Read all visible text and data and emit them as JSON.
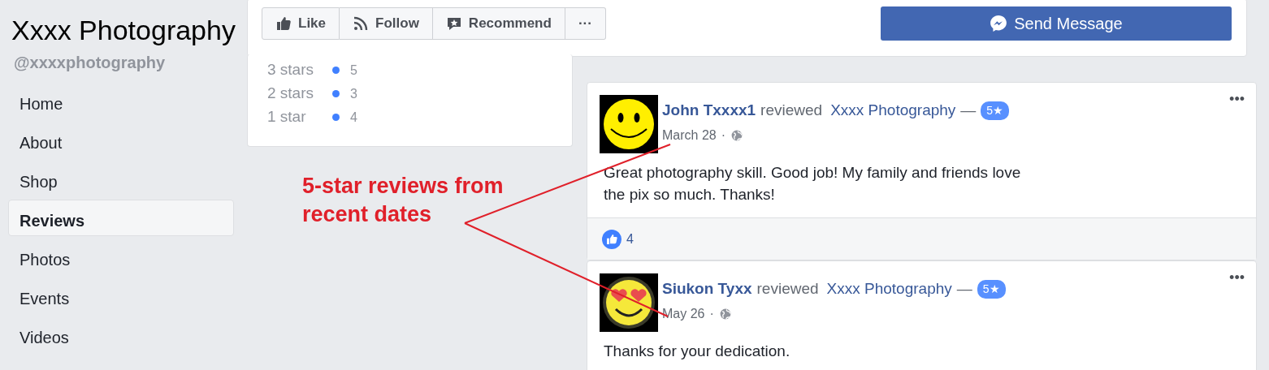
{
  "page": {
    "title": "Xxxx Photography",
    "handle": "@xxxxphotography"
  },
  "sidebar": {
    "items": [
      {
        "label": "Home",
        "selected": false
      },
      {
        "label": "About",
        "selected": false
      },
      {
        "label": "Shop",
        "selected": false
      },
      {
        "label": "Reviews",
        "selected": true
      },
      {
        "label": "Photos",
        "selected": false
      },
      {
        "label": "Events",
        "selected": false
      },
      {
        "label": "Videos",
        "selected": false
      }
    ]
  },
  "actions": [
    {
      "label": "Like",
      "kind": "like"
    },
    {
      "label": "Follow",
      "kind": "follow"
    },
    {
      "label": "Recommend",
      "kind": "recommend"
    },
    {
      "label": "···",
      "kind": "more"
    }
  ],
  "send_button": {
    "label": "Send Message"
  },
  "ratings": [
    {
      "label": "3 stars",
      "count": "5",
      "color": "#4080ff"
    },
    {
      "label": "2 stars",
      "count": "3",
      "color": "#4080ff"
    },
    {
      "label": "1 star",
      "count": "4",
      "color": "#4080ff"
    }
  ],
  "annotation": {
    "text": "5-star reviews from recent dates"
  },
  "reviews": [
    {
      "avatar": {
        "kind": "smiley"
      },
      "author": "John Txxxx1",
      "verb": "reviewed",
      "page": "Xxxx Photography",
      "dash": "—",
      "rating": "5★",
      "date": "March 28",
      "separator": "·",
      "menu": "•••",
      "body": "Great photography skill. Good job! My family and friends love the pix so much. Thanks!",
      "likes": "4"
    },
    {
      "avatar": {
        "kind": "heart_eyes"
      },
      "author": "Siukon Tyxx",
      "verb": "reviewed",
      "page": "Xxxx Photography",
      "dash": "—",
      "rating": "5★",
      "date": "May 26",
      "separator": "·",
      "menu": "•••",
      "body": "Thanks for your dedication."
    }
  ]
}
